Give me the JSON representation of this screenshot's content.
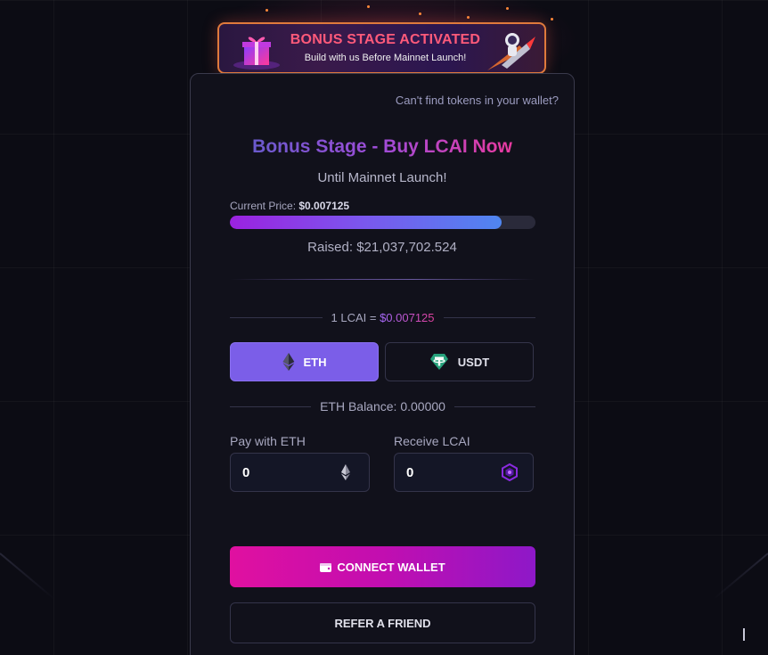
{
  "banner": {
    "title": "BONUS STAGE ACTIVATED",
    "subtitle": "Build with us Before Mainnet Launch!",
    "icons": [
      "gift-icon",
      "astronaut-rocket-icon"
    ]
  },
  "card": {
    "help_link": "Can't find tokens in your wallet?",
    "headline": "Bonus Stage - Buy LCAI Now",
    "subheadline": "Until Mainnet Launch!",
    "price_label": "Current Price:",
    "price_value": "$0.007125",
    "progress_fraction": 0.89,
    "raised_text": "Raised: $21,037,702.524",
    "rate_prefix": "1 LCAI = ",
    "rate_value": "$0.007125",
    "currencies": [
      {
        "label": "ETH",
        "icon": "ethereum-icon",
        "selected": true
      },
      {
        "label": "USDT",
        "icon": "tether-icon",
        "selected": false
      }
    ],
    "balance_text": "ETH Balance: 0.00000",
    "pay": {
      "label": "Pay with ETH",
      "value": "0",
      "icon": "ethereum-icon"
    },
    "receive": {
      "label": "Receive LCAI",
      "value": "0",
      "icon": "lcai-token-icon"
    },
    "connect_label": "CONNECT WALLET",
    "refer_label": "REFER A FRIEND"
  },
  "colors": {
    "accent_purple": "#7b5ee8",
    "accent_pink": "#e010a0",
    "banner_title": "#ff5a7a",
    "background": "#0c0c14"
  }
}
